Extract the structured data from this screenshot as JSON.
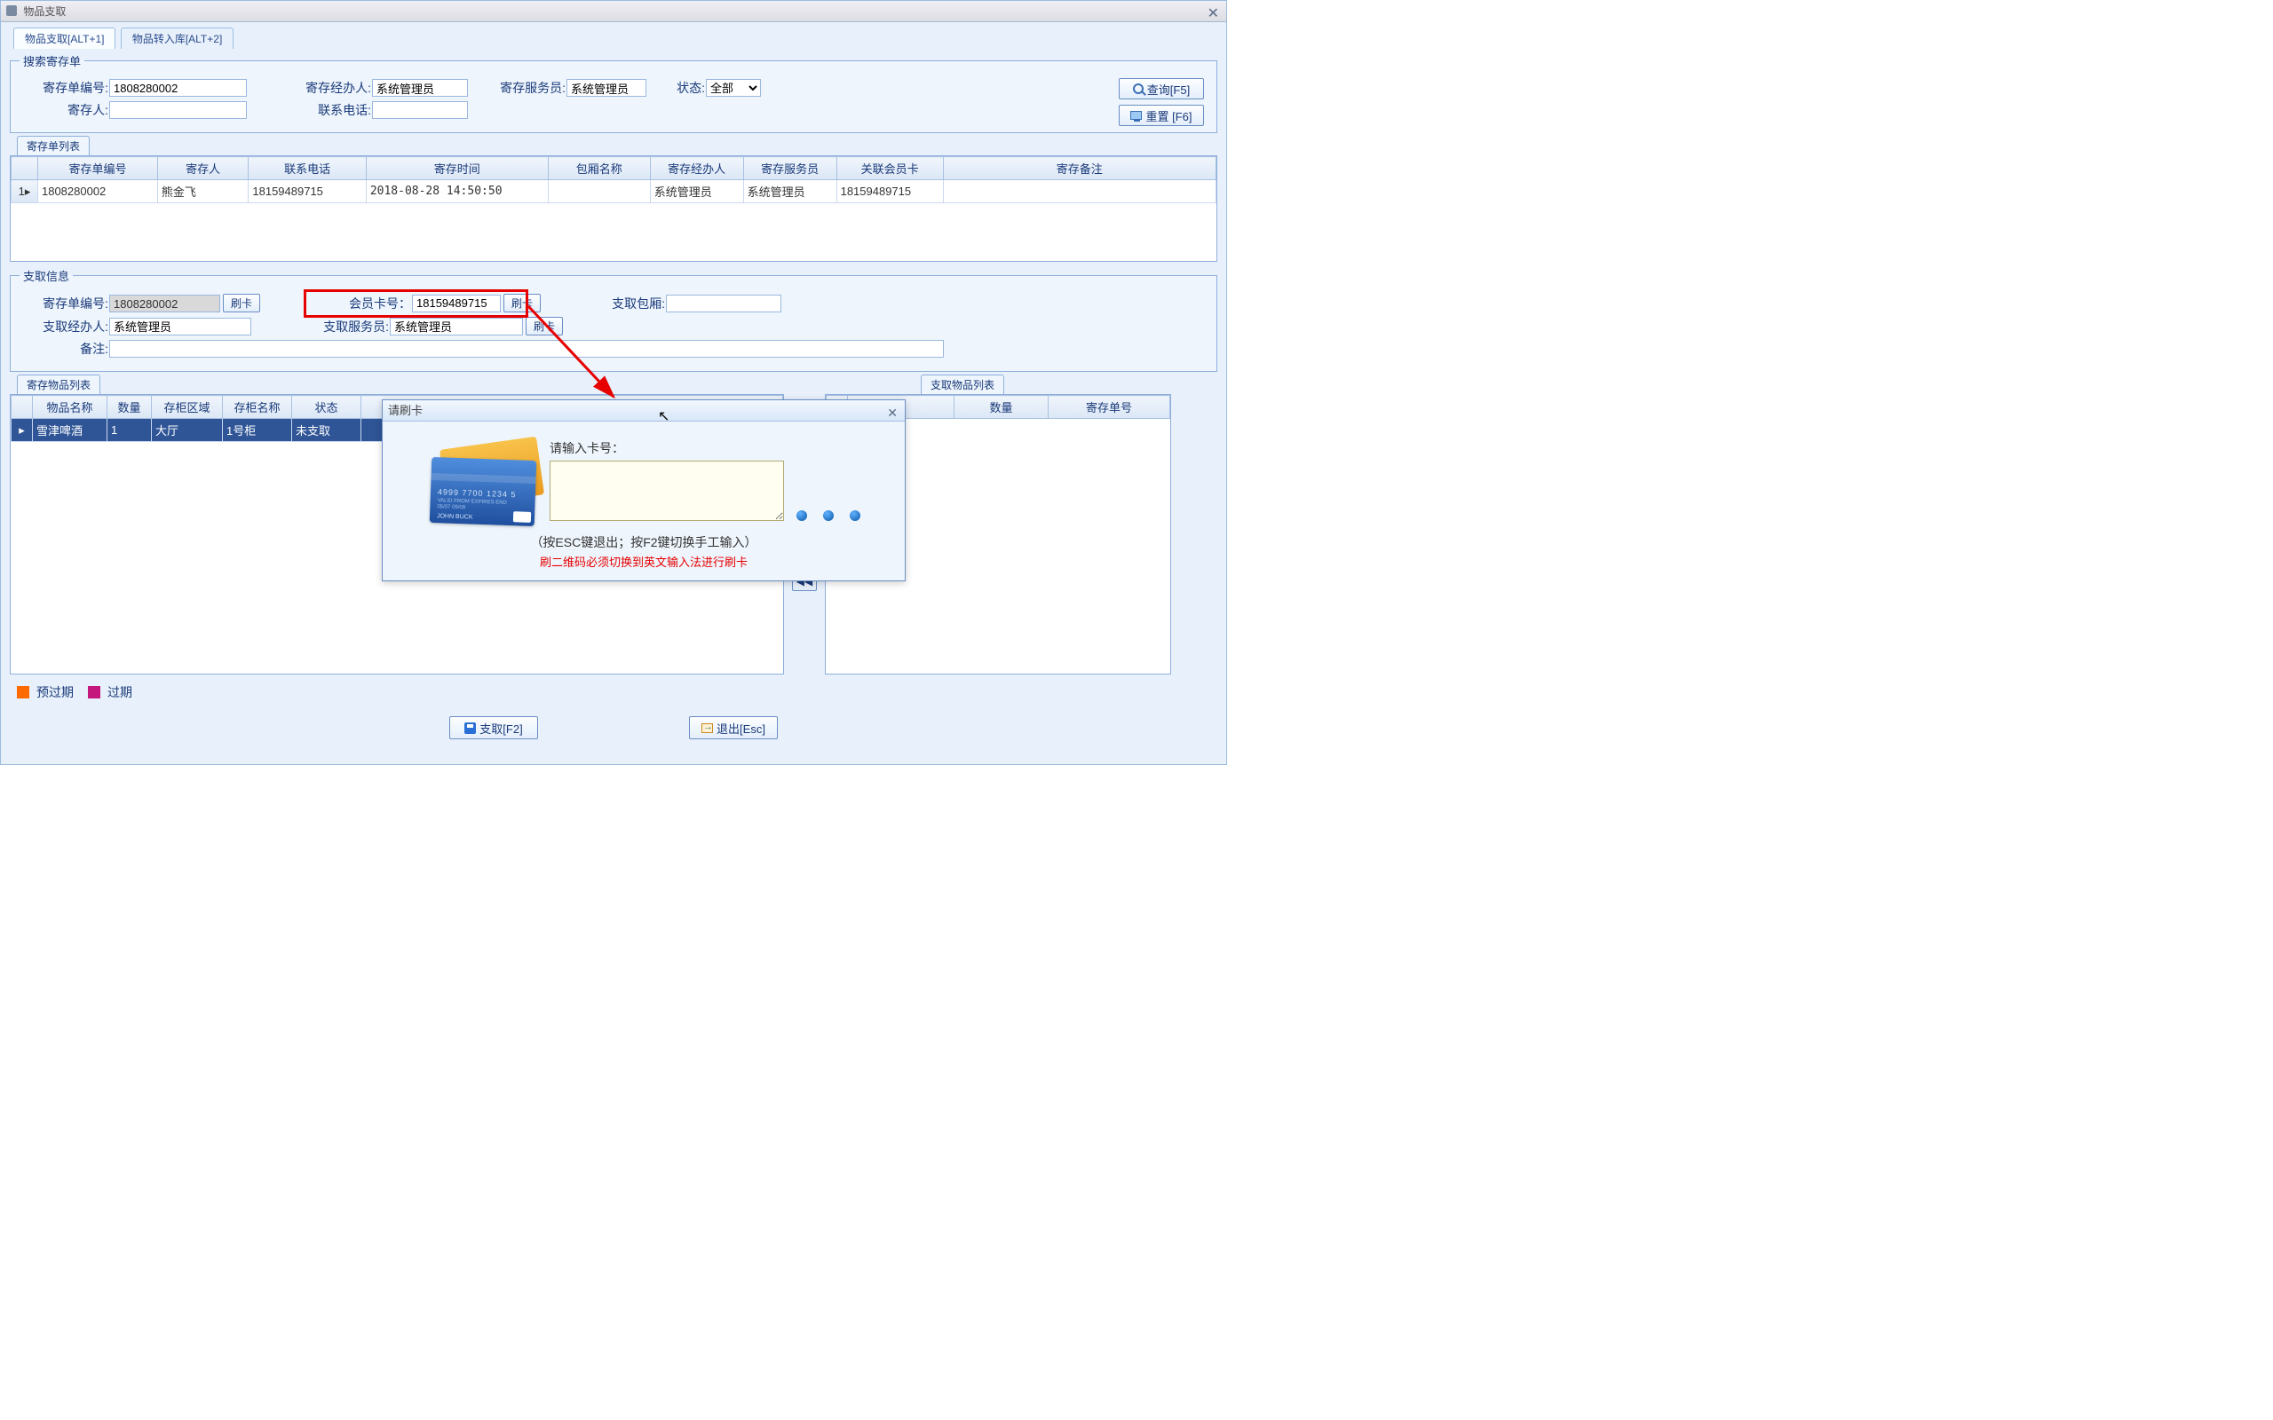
{
  "window_title": "物品支取",
  "tabs": {
    "withdraw": "物品支取[ALT+1]",
    "transfer": "物品转入库[ALT+2]"
  },
  "search": {
    "legend": "搜索寄存单",
    "deposit_no_label": "寄存单编号:",
    "deposit_no_value": "1808280002",
    "handler_label": "寄存经办人:",
    "handler_value": "系统管理员",
    "waiter_label": "寄存服务员:",
    "waiter_value": "系统管理员",
    "status_label": "状态:",
    "status_value": "全部",
    "depositor_label": "寄存人:",
    "depositor_value": "",
    "phone_label": "联系电话:",
    "phone_value": "",
    "query_btn": "查询[F5]",
    "reset_btn": "重置 [F6]"
  },
  "list_tab": "寄存单列表",
  "list_headers": [
    "寄存单编号",
    "寄存人",
    "联系电话",
    "寄存时间",
    "包厢名称",
    "寄存经办人",
    "寄存服务员",
    "关联会员卡",
    "寄存备注"
  ],
  "list_rows": [
    {
      "idx": "1",
      "cells": [
        "1808280002",
        "熊金飞",
        "18159489715",
        "2018-08-28 14:50:50",
        "",
        "系统管理员",
        "系统管理员",
        "18159489715",
        ""
      ]
    }
  ],
  "withdraw": {
    "legend": "支取信息",
    "deposit_no_label": "寄存单编号:",
    "deposit_no_value": "1808280002",
    "swipe1": "刷卡",
    "member_label": "会员卡号：",
    "member_value": "18159489715",
    "swipe2": "刷卡",
    "room_label": "支取包厢:",
    "room_value": "",
    "handler_label": "支取经办人:",
    "handler_value": "系统管理员",
    "waiter_label": "支取服务员:",
    "waiter_value": "系统管理员",
    "swipe3": "刷卡",
    "remark_label": "备注:",
    "remark_value": ""
  },
  "items_tab_left": "寄存物品列表",
  "items_tab_right": "支取物品列表",
  "items_headers_left": [
    "物品名称",
    "数量",
    "存柜区域",
    "存柜名称",
    "状态"
  ],
  "items_rows_left": [
    [
      "雪津啤酒",
      "1",
      "大厅",
      "1号柜",
      "未支取"
    ]
  ],
  "items_headers_right": [
    "数量",
    "寄存单号"
  ],
  "legend_overdue_soon": "预过期",
  "legend_overdue": "过期",
  "colors": {
    "overdue_soon": "#ff6a00",
    "overdue": "#c4187c"
  },
  "footer": {
    "withdraw_btn": "支取[F2]",
    "exit_btn": "退出[Esc]"
  },
  "modal": {
    "title": "请刷卡",
    "prompt": "请输入卡号：",
    "hint": "（按ESC键退出；按F2键切换手工输入）",
    "warn": "刷二维码必须切换到英文输入法进行刷卡"
  },
  "card_illus": {
    "number": "4999 7700 1234 5",
    "small": "VALID FROM  EXPIRES END",
    "dates": "05/07    05/09",
    "holder": "JOHN BUCK"
  }
}
